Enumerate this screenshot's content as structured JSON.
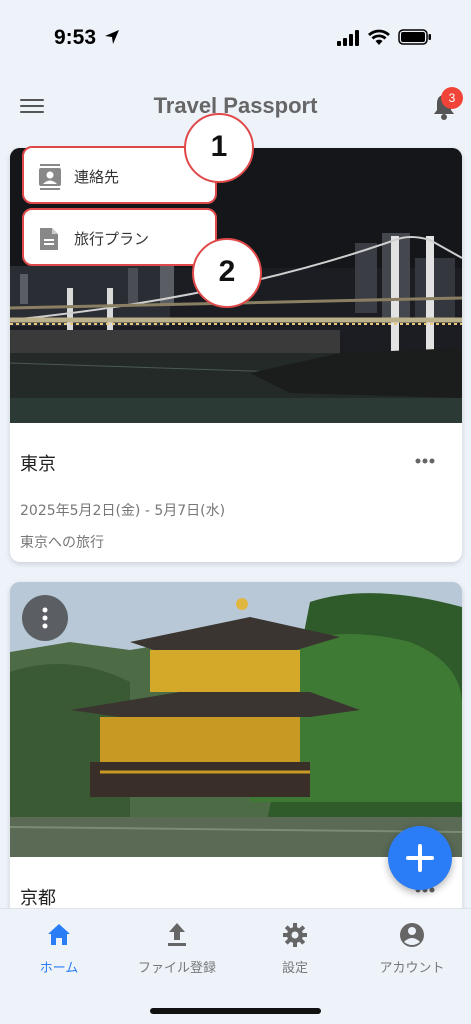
{
  "status_bar": {
    "time": "9:53"
  },
  "header": {
    "title": "Travel Passport",
    "notification_count": "3"
  },
  "menu": {
    "items": [
      {
        "label": "連絡先",
        "icon": "contact-icon"
      },
      {
        "label": "旅行プラン",
        "icon": "document-icon"
      }
    ]
  },
  "callouts": [
    "1",
    "2"
  ],
  "cards": [
    {
      "title": "東京",
      "dates": "2025年5月2日(金) - 5月7日(水)",
      "description": "東京への旅行",
      "image": "tokyo-bridge-night-photo"
    },
    {
      "title": "京都",
      "image": "kyoto-golden-pavilion-photo"
    }
  ],
  "bottom_nav": {
    "items": [
      {
        "label": "ホーム",
        "icon": "home-icon",
        "active": true
      },
      {
        "label": "ファイル登録",
        "icon": "upload-icon"
      },
      {
        "label": "設定",
        "icon": "gear-icon"
      },
      {
        "label": "アカウント",
        "icon": "account-icon"
      }
    ]
  },
  "colors": {
    "accent": "#2a7df6",
    "badge": "#f04438",
    "callout_border": "#e0494a"
  }
}
